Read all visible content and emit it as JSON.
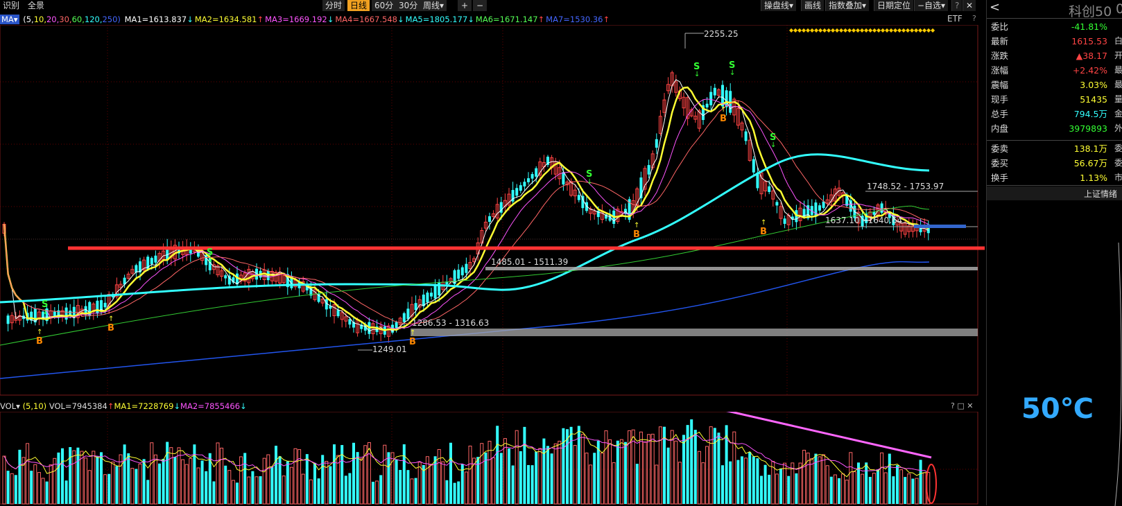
{
  "toolbar": {
    "left_items": [
      "识别",
      "全景"
    ],
    "periods": [
      "分时",
      "日线",
      "60分",
      "30分",
      "周线▾"
    ],
    "active_period": "日线",
    "plus": "+",
    "minus": "−",
    "right_items": [
      "操盘线▾",
      "画线",
      "指数叠加▾",
      "日期定位",
      "−自选▾",
      "?"
    ],
    "close": "✕"
  },
  "ma_legend": {
    "label": "MA▾",
    "params_parts": [
      {
        "text": "(5,",
        "color": "#ffffff"
      },
      {
        "text": "10,",
        "color": "#ffff33"
      },
      {
        "text": "20,",
        "color": "#ff55ff"
      },
      {
        "text": "30,",
        "color": "#ff6666"
      },
      {
        "text": "60,",
        "color": "#55ff55"
      },
      {
        "text": "120,",
        "color": "#33ffff"
      },
      {
        "text": "250)",
        "color": "#4466ff"
      }
    ],
    "items": [
      {
        "text": "MA1=1613.837",
        "arrow": "↓",
        "color": "#ffffff",
        "arrow_color": "#33ffff"
      },
      {
        "text": "MA2=1634.581",
        "arrow": "↑",
        "color": "#ffff33",
        "arrow_color": "#ff4444"
      },
      {
        "text": "MA3=1669.192",
        "arrow": "↓",
        "color": "#ff55ff",
        "arrow_color": "#33ffff"
      },
      {
        "text": "MA4=1667.548",
        "arrow": "↓",
        "color": "#ff6666",
        "arrow_color": "#33ffff"
      },
      {
        "text": "MA5=1805.177",
        "arrow": "↓",
        "color": "#33ffff",
        "arrow_color": "#33ffff"
      },
      {
        "text": "MA6=1671.147",
        "arrow": "↑",
        "color": "#55ff55",
        "arrow_color": "#ff4444"
      },
      {
        "text": "MA7=1530.36",
        "arrow": "↑",
        "color": "#4466ff",
        "arrow_color": "#ff4444"
      }
    ],
    "etf": "ETF",
    "q": "?"
  },
  "chart_labels": {
    "high": "2255.25",
    "low": "1249.01",
    "zone1": "1286.53 - 1316.63",
    "zone2": "1485.01 - 1511.39",
    "zone3": "1748.52 - 1753.97",
    "zone4": "1637.10 - 1640.64"
  },
  "signals": [
    {
      "t": "B",
      "color": "#ff8800"
    },
    {
      "t": "S",
      "color": "#33ff33"
    }
  ],
  "vol_legend": {
    "label": "VOL▾",
    "params": "(5,10)",
    "vol": "VOL=7945384",
    "vol_arrow": "↑",
    "ma1": "MA1=7228769",
    "ma1_arrow": "↓",
    "ma2": "MA2=7855466",
    "ma2_arrow": "↓",
    "controls": "? □ ✕"
  },
  "panel": {
    "back": "<",
    "title": "科创50",
    "title_cut": "0",
    "rows": [
      {
        "label": "委比",
        "value": "-41.81%",
        "color": "#33ff33",
        "extra": ""
      },
      {
        "label": "最新",
        "value": "1615.53",
        "color": "#ff4444",
        "extra": "白"
      },
      {
        "label": "涨跌",
        "value": "▲38.17",
        "color": "#ff4444",
        "extra": "开"
      },
      {
        "label": "涨幅",
        "value": "+2.42%",
        "color": "#ff4444",
        "extra": "最"
      },
      {
        "label": "震幅",
        "value": "3.03%",
        "color": "#ffff33",
        "extra": "最"
      },
      {
        "label": "现手",
        "value": "51435",
        "color": "#ffff33",
        "extra": "量"
      },
      {
        "label": "总手",
        "value": "794.5万",
        "color": "#33ffff",
        "extra": "金"
      },
      {
        "label": "内盘",
        "value": "3979893",
        "color": "#33ff33",
        "extra": "外"
      },
      {
        "label": "委卖",
        "value": "138.1万",
        "color": "#ffff33",
        "extra": "委"
      },
      {
        "label": "委买",
        "value": "56.67万",
        "color": "#ffff33",
        "extra": "委"
      },
      {
        "label": "换手",
        "value": "1.13%",
        "color": "#ffff33",
        "extra": "市"
      }
    ],
    "sentiment_title": "上证情绪",
    "temperature": "50℃"
  },
  "colors": {
    "up": "#ff4444",
    "down": "#33ffff",
    "support": "#ff3333",
    "trend": "#ff66ff"
  }
}
